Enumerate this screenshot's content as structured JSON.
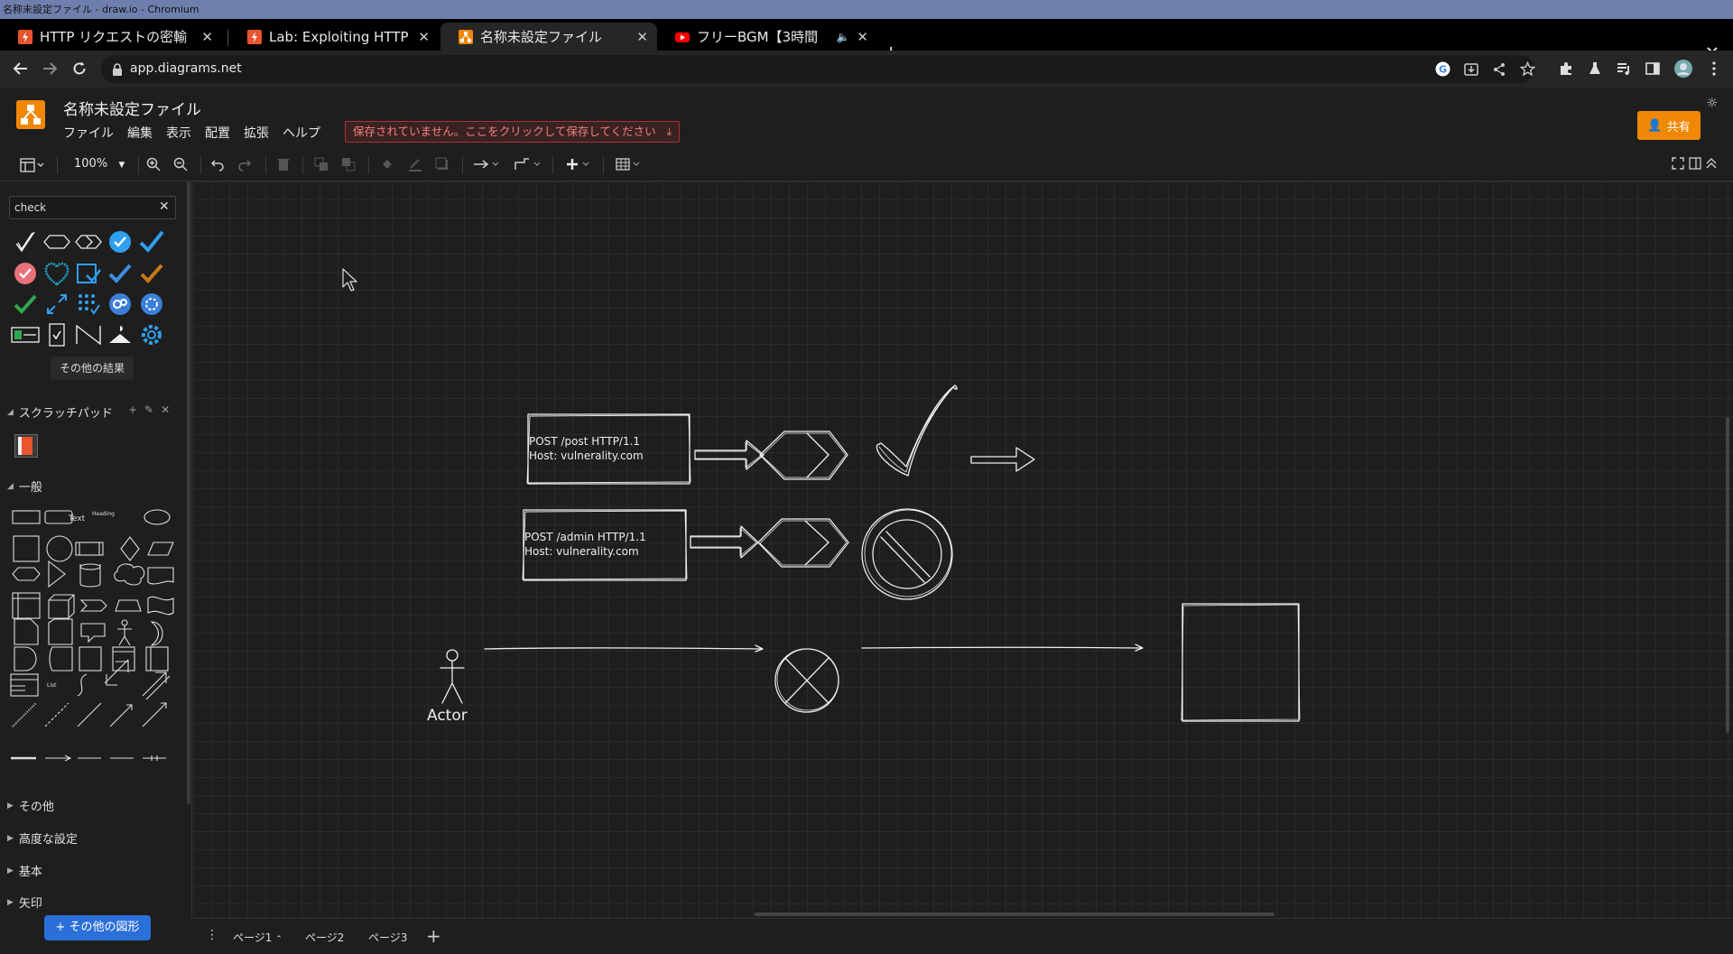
{
  "window_title": "名称未設定ファイル - draw.io - Chromium",
  "tabs": [
    {
      "label": "HTTP リクエストの密輸",
      "icon": "portswigger-icon",
      "active": false
    },
    {
      "label": "Lab: Exploiting HTTP",
      "icon": "portswigger-icon",
      "active": false
    },
    {
      "label": "名称未設定ファイル",
      "icon": "drawio-icon",
      "active": true
    },
    {
      "label": "フリーBGM【3時間",
      "icon": "youtube-icon",
      "active": false,
      "audio": true
    }
  ],
  "url": "app.diagrams.net",
  "doc_title": "名称未設定ファイル",
  "menu": [
    "ファイル",
    "編集",
    "表示",
    "配置",
    "拡張",
    "ヘルプ"
  ],
  "unsaved_notice": "保存されていません。ここをクリックして保存してください",
  "share_label": "共有",
  "zoom": "100%",
  "sidebar": {
    "search_value": "check",
    "more_results": "その他の結果",
    "scratchpad_label": "スクラッチパッド",
    "general_label": "一般",
    "sections": [
      "その他",
      "高度な設定",
      "基本",
      "矢印"
    ],
    "more_shapes": "+ その他の図形",
    "general_text_shape": "Text",
    "general_heading_shape": "Heading",
    "general_list_shape": "List"
  },
  "diagram": {
    "box1_line1": "POST /post HTTP/1.1",
    "box1_line2": "Host: vulnerality.com",
    "box2_line1": "POST /admin HTTP/1.1",
    "box2_line2": "Host: vulnerality.com",
    "actor_label": "Actor"
  },
  "pages": [
    "ページ1",
    "ページ2",
    "ページ3"
  ],
  "colors": {
    "accent": "#f08705",
    "primary_button": "#2b6fd9",
    "unsaved": "#f08080"
  }
}
